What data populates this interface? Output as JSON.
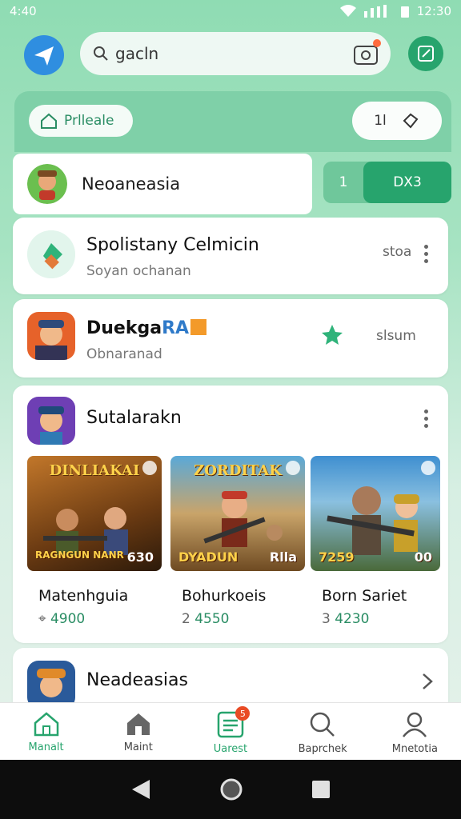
{
  "status": {
    "time_left": "4:40",
    "time_right": "12:30"
  },
  "search": {
    "text": "gacln"
  },
  "hero": {
    "private_label": "Prlleale",
    "right_label": "1l"
  },
  "top_row": {
    "name": "Neoaneasia",
    "tab1": "1",
    "tab2": "DX3"
  },
  "cards": [
    {
      "title": "Spolistany Celmicin",
      "subtitle": "Soyan ochanan",
      "right_text": "stoa"
    },
    {
      "title": "Duekga",
      "title_badge": "RA",
      "subtitle": "Obnaranad",
      "right_text": "slsum"
    },
    {
      "title": "Sutalarakn"
    }
  ],
  "tiles": [
    {
      "thumb_title": "DINLIAKAI",
      "thumb_bottom_left": "RAGNGUN NANR",
      "thumb_bottom_right": "630",
      "name": "Matenhguia",
      "score": "4900",
      "score_prefix": "⌖"
    },
    {
      "thumb_title": "ZORDITAK",
      "thumb_bottom_left": "DYADUN",
      "thumb_bottom_right": "Rlla",
      "name": "Bohurkoeis",
      "score": "4550",
      "score_prefix": "2"
    },
    {
      "thumb_title": "",
      "thumb_bottom_left": "7259",
      "thumb_bottom_right": "00",
      "name": "Born Sariet",
      "score": "4230",
      "score_prefix": "3"
    }
  ],
  "last_row": {
    "title": "Neadeasias"
  },
  "nav": [
    {
      "label": "Manalt",
      "icon": "home-icon",
      "active": true
    },
    {
      "label": "Maint",
      "icon": "house-icon",
      "active": false
    },
    {
      "label": "Uarest",
      "icon": "list-icon",
      "active": false,
      "badge": "5"
    },
    {
      "label": "Baprchek",
      "icon": "search-icon",
      "active": false
    },
    {
      "label": "Mnetotia",
      "icon": "person-icon",
      "active": false
    }
  ],
  "colors": {
    "accent": "#27a46d",
    "hero": "#7fd0a8",
    "badge": "#e94b25"
  }
}
